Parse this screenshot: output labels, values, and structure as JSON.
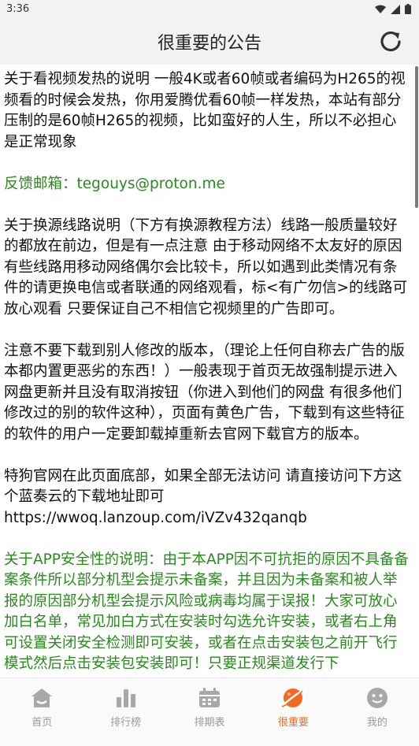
{
  "status_bar": {
    "time": "3:36"
  },
  "app_bar": {
    "title": "很重要的公告"
  },
  "paragraphs": [
    {
      "text": "关于看视频发热的说明 一般4K或者60帧或者编码为H265的视频看的时候会发热，你用爱腾优看60帧一样发热，本站有部分压制的是60帧H265的视频，比如蛮好的人生，所以不必担心 是正常现象",
      "color": "normal"
    },
    {
      "text": "反馈邮箱：tegouys@proton.me",
      "color": "green"
    },
    {
      "text": "关于换源线路说明（下方有换源教程方法）线路一般质量较好的都放在前边，但是有一点注意 由于移动网络不太友好的原因有些线路用移动网络偶尔会比较卡，所以如遇到此类情况有条件的请更换电信或者联通的网络观看，标<有广勿信>的线路可放心观看 只要保证自己不相信它视频里的广告即可。",
      "color": "normal"
    },
    {
      "text": "注意不要下载到别人修改的版本，（理论上任何自称去广告的版本都内置更恶劣的东西！）一般表现于首页无故强制提示进入网盘更新并且没有取消按钮（你进入到他们的网盘 有很多他们修改过的别的软件这种），页面有黄色广告，下载到有这些特征的软件的用户一定要卸载掉重新去官网下载官方的版本。",
      "color": "normal"
    },
    {
      "text": "特狗官网在此页面底部，如果全部无法访问 请直接访问下方这个蓝奏云的下载地址即可\nhttps://wwoq.lanzoup.com/iVZv432qanqb",
      "color": "normal"
    },
    {
      "text": "关于APP安全性的说明：由于本APP因不可抗拒的原因不具备备案条件所以部分机型会提示未备案，并且因为未备案和被人举报的原因部分机型会提示风险或病毒均属于误报！大家可放心加白名单，常见加白方式在安装时勾选允许安装，或者右上角可设置关闭安全检测即可安装，或者在点击安装包之前开飞行模式然后点击安装包安装即可！只要正规渠道发行下",
      "color": "green"
    }
  ],
  "tabs": [
    {
      "label": "首页",
      "icon": "home-icon",
      "active": false
    },
    {
      "label": "排行榜",
      "icon": "bar-chart-icon",
      "active": false
    },
    {
      "label": "排期表",
      "icon": "calendar-icon",
      "active": false
    },
    {
      "label": "很重要",
      "icon": "planet-icon",
      "active": true
    },
    {
      "label": "我的",
      "icon": "smiley-icon",
      "active": false
    }
  ],
  "colors": {
    "accent": "#f26a21",
    "green_text": "#2a8a1e",
    "inactive": "#9a9a9a"
  }
}
